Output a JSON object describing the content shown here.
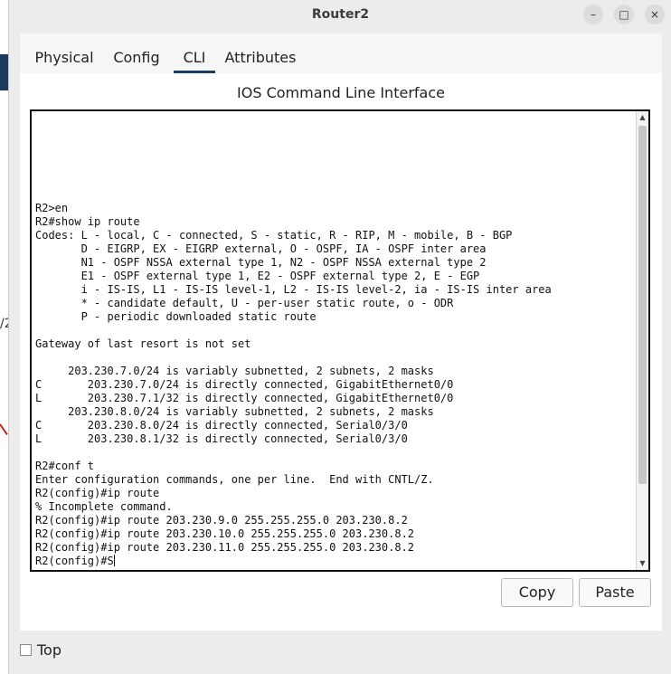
{
  "window": {
    "title": "Router2",
    "minimize_glyph": "–",
    "maximize_glyph": "□",
    "close_glyph": "×"
  },
  "background": {
    "partial_text": "/2"
  },
  "tabs": [
    {
      "label": "Physical",
      "active": false
    },
    {
      "label": "Config",
      "active": false
    },
    {
      "label": "CLI",
      "active": true
    },
    {
      "label": "Attributes",
      "active": false
    }
  ],
  "cli": {
    "title": "IOS Command Line Interface",
    "lines": [
      "R2>en",
      "R2#show ip route",
      "Codes: L - local, C - connected, S - static, R - RIP, M - mobile, B - BGP",
      "       D - EIGRP, EX - EIGRP external, O - OSPF, IA - OSPF inter area",
      "       N1 - OSPF NSSA external type 1, N2 - OSPF NSSA external type 2",
      "       E1 - OSPF external type 1, E2 - OSPF external type 2, E - EGP",
      "       i - IS-IS, L1 - IS-IS level-1, L2 - IS-IS level-2, ia - IS-IS inter area",
      "       * - candidate default, U - per-user static route, o - ODR",
      "       P - periodic downloaded static route",
      "",
      "Gateway of last resort is not set",
      "",
      "     203.230.7.0/24 is variably subnetted, 2 subnets, 2 masks",
      "C       203.230.7.0/24 is directly connected, GigabitEthernet0/0",
      "L       203.230.7.1/32 is directly connected, GigabitEthernet0/0",
      "     203.230.8.0/24 is variably subnetted, 2 subnets, 2 masks",
      "C       203.230.8.0/24 is directly connected, Serial0/3/0",
      "L       203.230.8.1/32 is directly connected, Serial0/3/0",
      "",
      "R2#conf t",
      "Enter configuration commands, one per line.  End with CNTL/Z.",
      "R2(config)#ip route",
      "% Incomplete command.",
      "R2(config)#ip route 203.230.9.0 255.255.255.0 203.230.8.2",
      "R2(config)#ip route 203.230.10.0 255.255.255.0 203.230.8.2",
      "R2(config)#ip route 203.230.11.0 255.255.255.0 203.230.8.2",
      "R2(config)#S"
    ]
  },
  "buttons": {
    "copy": "Copy",
    "paste": "Paste"
  },
  "footer": {
    "top_label": "Top",
    "top_checked": false
  },
  "colors": {
    "tab_active_underline": "#1a3d66",
    "window_bg": "#ececec",
    "panel_bg": "#ffffff"
  },
  "icons": {
    "scroll_up": "scroll-up-arrow-icon",
    "scroll_down": "scroll-down-arrow-icon",
    "minimize": "minimize-icon",
    "maximize": "maximize-icon",
    "close": "close-icon"
  }
}
